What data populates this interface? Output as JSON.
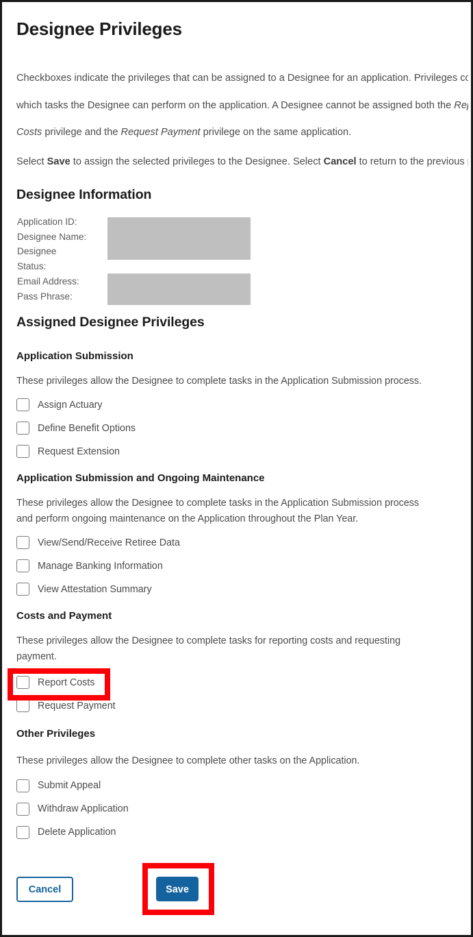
{
  "page": {
    "title": "Designee Privileges",
    "intro_lines": [
      "Checkboxes indicate the privileges that can be assigned to a Designee for an application. Privileges control",
      "which tasks the Designee can perform on the application. A Designee cannot be assigned both the ",
      "Report",
      "Costs",
      " privilege and the ",
      "Request Payment",
      " privilege on the same application."
    ],
    "intro_paragraph_1_a": "Checkboxes indicate the privileges that can be assigned to a Designee for an application. Privileges control",
    "intro_paragraph_1_b": "which tasks the Designee can perform on the application. A Designee cannot be assigned both the ",
    "intro_em_1": "Report Costs",
    "intro_paragraph_1_c": " privilege and the ",
    "intro_em_2": "Request Payment",
    "intro_paragraph_1_d": " privilege on the same application.",
    "intro_paragraph_2_a": "Select ",
    "intro_strong_save": "Save",
    "intro_paragraph_2_b": " to assign the selected privileges to the Designee. Select ",
    "intro_strong_cancel": "Cancel",
    "intro_paragraph_2_c": " to return to the previous page."
  },
  "designee_information": {
    "heading": "Designee Information",
    "fields": [
      {
        "label": "Application ID:",
        "value": "",
        "redacted": true
      },
      {
        "label": "Designee Name:",
        "value": "",
        "redacted": true
      },
      {
        "label": "Designee",
        "value": "",
        "redacted": true
      },
      {
        "label": "Status:",
        "value": "",
        "redacted": true
      },
      {
        "label": "Email Address:",
        "value": "",
        "redacted": true
      },
      {
        "label": "Pass Phrase:",
        "value": "",
        "redacted": true
      }
    ]
  },
  "assigned_privileges": {
    "heading": "Assigned Designee Privileges",
    "groups": [
      {
        "title": "Application Submission",
        "description": "These privileges allow the Designee to complete tasks in the Application Submission process.",
        "options": [
          {
            "label": "Assign Actuary",
            "checked": false
          },
          {
            "label": "Define Benefit Options",
            "checked": false
          },
          {
            "label": "Request Extension",
            "checked": false
          }
        ]
      },
      {
        "title": "Application Submission and Ongoing Maintenance",
        "description": "These privileges allow the Designee to complete tasks in the Application Submission process and perform ongoing maintenance on the Application throughout the Plan Year.",
        "options": [
          {
            "label": "View/Send/Receive Retiree Data",
            "checked": false
          },
          {
            "label": "Manage Banking Information",
            "checked": false
          },
          {
            "label": "View Attestation Summary",
            "checked": false
          }
        ]
      },
      {
        "title": "Costs and Payment",
        "description": "These privileges allow the Designee to complete tasks for reporting costs and requesting payment.",
        "options": [
          {
            "label": "Report Costs",
            "checked": false
          },
          {
            "label": "Request Payment",
            "checked": false
          }
        ]
      },
      {
        "title": "Other Privileges",
        "description": "These privileges allow the Designee to complete other tasks on the Application.",
        "options": [
          {
            "label": "Submit Appeal",
            "checked": false
          },
          {
            "label": "Withdraw Application",
            "checked": false
          },
          {
            "label": "Delete Application",
            "checked": false
          }
        ]
      }
    ]
  },
  "footer": {
    "cancel_label": "Cancel",
    "save_label": "Save"
  },
  "annotations": {
    "highlight_color": "#fb0007",
    "targets": [
      "Report Costs",
      "Save"
    ]
  },
  "colors": {
    "primary_blue": "#15639e",
    "annotation_red": "#fb0007",
    "redaction_gray": "#bfbfbf",
    "body_text": "#4b4b4b",
    "heading_text": "#1b1b1b"
  }
}
